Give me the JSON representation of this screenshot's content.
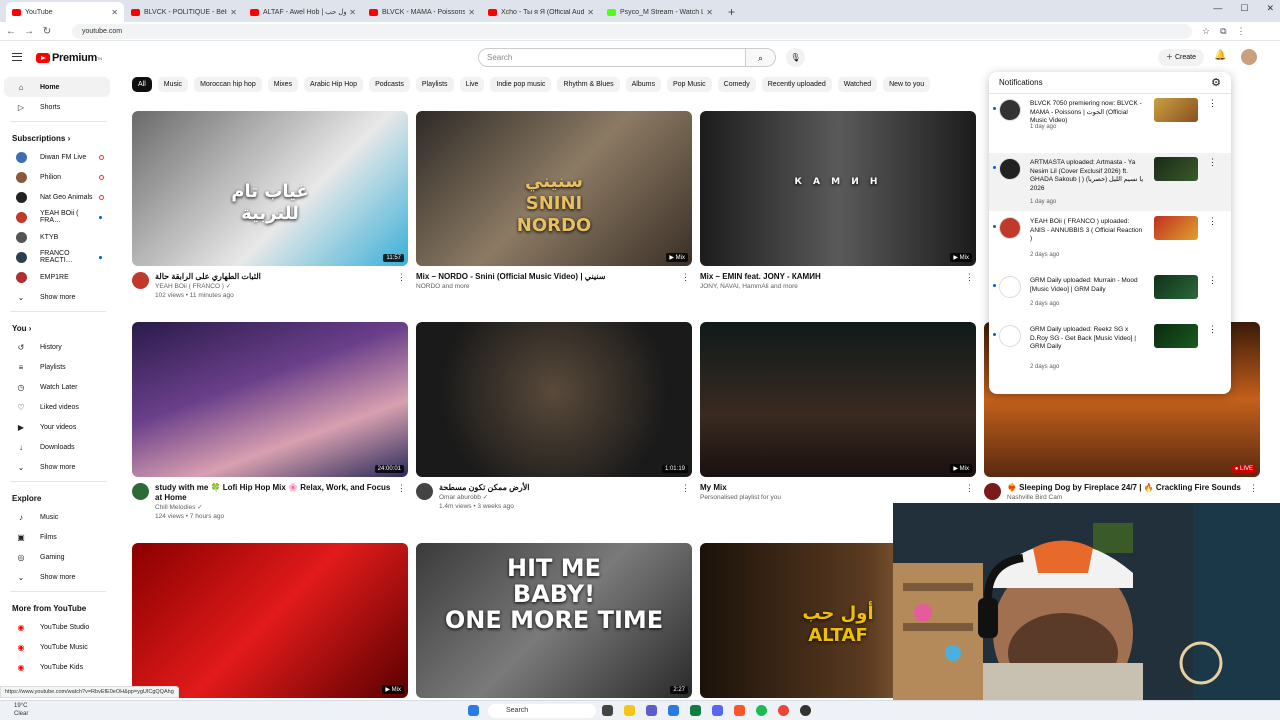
{
  "browser": {
    "tabs": [
      {
        "label": "YouTube",
        "color": "#ff0000",
        "active": true
      },
      {
        "label": "BLVCK - POLITIQUE - Bélier [Of…",
        "color": "#ff0000"
      },
      {
        "label": "ALTAF - Awel Hob | أول حب [Cli…",
        "color": "#ff0000"
      },
      {
        "label": "BLVCK - MAMA - Poissons | الحوت…",
        "color": "#ff0000"
      },
      {
        "label": "Xcho - Ты я Я (Official Audi…",
        "color": "#ff0000"
      },
      {
        "label": "Psyco_M Stream - Watch Live o…",
        "color": "#53fc18"
      }
    ],
    "new_tab": "+",
    "url": "youtube.com",
    "status_url": "https://www.youtube.com/watch?v=RbvEfE0eOH&pp=ygUICgQQAhg"
  },
  "header": {
    "logo_text": "Premium",
    "logo_tm": "TN",
    "search_placeholder": "Search",
    "create_label": "Create"
  },
  "sidebar": {
    "main": [
      {
        "label": "Home",
        "icon": "⌂",
        "active": true
      },
      {
        "label": "Shorts",
        "icon": "▷"
      }
    ],
    "subscriptions_title": "Subscriptions",
    "subscriptions": [
      {
        "label": "Diwan FM Live",
        "color": "#3a6fb5",
        "live": true
      },
      {
        "label": "Philion",
        "color": "#8a5a3c",
        "live": true
      },
      {
        "label": "Nat Geo Animals",
        "color": "#222222",
        "live": true
      },
      {
        "label": "YEAH BOii ( FRA…",
        "color": "#c0392b",
        "dot": true
      },
      {
        "label": "KTYB",
        "color": "#555555"
      },
      {
        "label": "FRANCO REACTI…",
        "color": "#2c3e50",
        "dot": true
      },
      {
        "label": "EMP1RE",
        "color": "#b03030"
      }
    ],
    "subs_more": "Show more",
    "you_title": "You",
    "you": [
      {
        "label": "History",
        "icon": "↺"
      },
      {
        "label": "Playlists",
        "icon": "≡"
      },
      {
        "label": "Watch Later",
        "icon": "◷"
      },
      {
        "label": "Liked videos",
        "icon": "♡"
      },
      {
        "label": "Your videos",
        "icon": "▶"
      },
      {
        "label": "Downloads",
        "icon": "↓"
      }
    ],
    "you_more": "Show more",
    "explore_title": "Explore",
    "explore": [
      {
        "label": "Music",
        "icon": "♪"
      },
      {
        "label": "Films",
        "icon": "▣"
      },
      {
        "label": "Gaming",
        "icon": "◎"
      }
    ],
    "explore_more": "Show more",
    "more_title": "More from YouTube",
    "more": [
      {
        "label": "YouTube Studio"
      },
      {
        "label": "YouTube Music"
      },
      {
        "label": "YouTube Kids"
      }
    ]
  },
  "chips": [
    "All",
    "Music",
    "Moroccan hip hop",
    "Mixes",
    "Arabic Hip Hop",
    "Podcasts",
    "Playlists",
    "Live",
    "Indie pop music",
    "Rhythm & Blues",
    "Albums",
    "Pop Music",
    "Comedy",
    "Recently uploaded",
    "Watched",
    "New to you"
  ],
  "videos": [
    {
      "title": "الثبات الطهاري على الرابقة حالة",
      "channel": "YEAH BOii ( FRANCO ) ✓",
      "stats": "102 views • 11 minutes ago",
      "duration": "11:57",
      "overlay": "غياب تام\nللتربية",
      "bg": "linear-gradient(135deg,#6a6a6a,#e8e8e8 60%,#3ab0d8)",
      "avatar": "#c0392b"
    },
    {
      "title": "Mix – NORDO - Snini (Official Music Video) | سنيني",
      "channel": "NORDO and more",
      "stats": "",
      "duration": "▶ Mix",
      "overlay": "سنيني\nSNINI\nNORDO",
      "bg": "linear-gradient(135deg,#2e2a26,#8c7a64 50%,#3b3027)",
      "avatar": ""
    },
    {
      "title": "Mix – EMIN feat. JONY - КАМИН",
      "channel": "JONY, NAVAI, HammAli and more",
      "stats": "",
      "duration": "▶ Mix",
      "overlay": "К А М И Н",
      "bg": "linear-gradient(90deg,#1c1c1c,#5a5a5a 50%,#1c1c1c)",
      "avatar": ""
    },
    {
      "title": "study with me 🍀 Lofi Hip Hop Mix 🌸 Relax, Work, and Focus at Home",
      "channel": "Chill Melodies ✓",
      "stats": "124 views • 7 hours ago",
      "duration": "24:00:01",
      "overlay": "",
      "bg": "linear-gradient(160deg,#2a1b4a,#6a3f8a 40%,#d8a0b0 70%,#2a2a5a)",
      "avatar": "#2d6a3a"
    },
    {
      "title": "الأرض ممكن تكون مسطحة",
      "channel": "Omar aburobb ✓",
      "stats": "1.4m views • 3 weeks ago",
      "duration": "1:01:19",
      "overlay": "",
      "bg": "radial-gradient(circle at 50% 45%,#5a4a3a,#1a1a1a 70%)",
      "avatar": "#444444"
    },
    {
      "title": "My Mix",
      "channel": "Personalised playlist for you",
      "stats": "",
      "duration": "▶ Mix",
      "overlay": "",
      "bg": "linear-gradient(180deg,#0e1a1a,#3a2a20 60%,#1a1010)",
      "avatar": ""
    },
    {
      "title": "❤️‍🔥 Sleeping Dog by Fireplace 24/7 | 🔥 Crackling Fire Sounds",
      "channel": "Nashville Bird Cam",
      "stats": "",
      "duration": "● LIVE",
      "overlay": "",
      "bg": "linear-gradient(180deg,#3a1a08,#c4601c 50%,#5a2a10)",
      "avatar": "#7a1a1a"
    },
    {
      "title": "",
      "channel": "",
      "stats": "",
      "duration": "▶ Mix",
      "overlay": "",
      "bg": "linear-gradient(135deg,#8a0000,#e21a1a 50%,#5a0000)",
      "avatar": ""
    },
    {
      "title": "",
      "channel": "",
      "stats": "",
      "duration": "2:27",
      "overlay": "HIT ME\nBABY!\nONE MORE TIME",
      "bg": "linear-gradient(135deg,#3a3a3a,#7a7a7a 50%,#2a2a2a)",
      "avatar": ""
    },
    {
      "title": "",
      "channel": "",
      "stats": "",
      "duration": "",
      "overlay": "أول حب\nALTAF",
      "bg": "linear-gradient(90deg,#1a120a,#5a3a20 60%,#c08a50)",
      "avatar": ""
    }
  ],
  "notifications": {
    "title": "Notifications",
    "items": [
      {
        "text": "BLVCK 7050 premiering now: BLVCK - MAMA - Poissons | الحوت (Official Music Video)",
        "time": "1 day ago",
        "avatar": "#333333",
        "thumb": "linear-gradient(135deg,#c8a040,#8a5020)"
      },
      {
        "text": "ARTMASTA uploaded: Artmasta - Ya Nesim Lil (Cover Exclusif 2026) ft. GHADA Sakoub | يا نسيم الليل (حصريا) ( 2026",
        "time": "1 day ago",
        "avatar": "#222222",
        "thumb": "linear-gradient(135deg,#1a2a1a,#3a5a2a)"
      },
      {
        "text": "YEAH BOii ( FRANCO ) uploaded: ANIS - ANNUBBIS 3 ( Official Reaction )",
        "time": "2 days ago",
        "avatar": "#c0392b",
        "thumb": "linear-gradient(135deg,#c03020,#e0a030)"
      },
      {
        "text": "GRM Daily uploaded: Murrain - Mood [Music Video] | GRM Daily",
        "time": "2 days ago",
        "avatar": "#ffffff",
        "thumb": "linear-gradient(135deg,#103018,#2a6a3a)"
      },
      {
        "text": "GRM Daily uploaded: Reekz SG x D.Roy SG - Get Back [Music Video] | GRM Daily",
        "time": "2 days ago",
        "avatar": "#ffffff",
        "thumb": "linear-gradient(135deg,#0a2a10,#1a5a20)"
      }
    ]
  },
  "taskbar": {
    "search_label": "Search",
    "weather_temp": "19°C",
    "weather_desc": "Clear"
  }
}
